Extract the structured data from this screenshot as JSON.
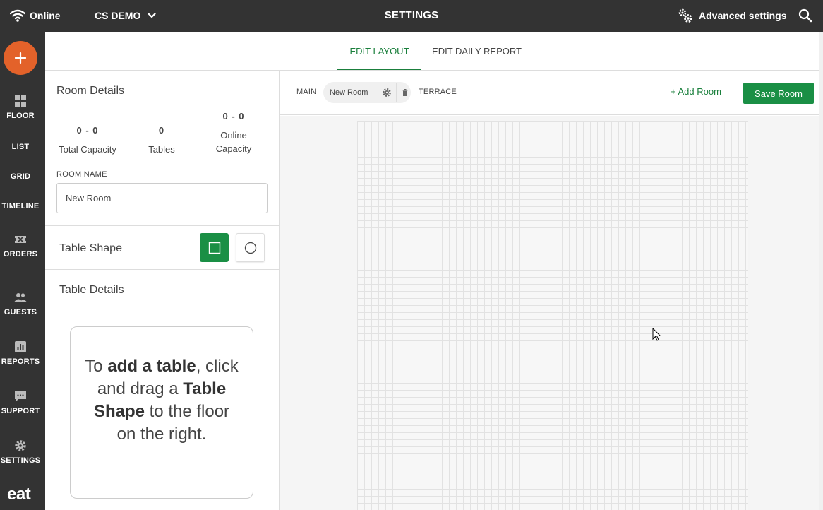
{
  "topbar": {
    "status": "Online",
    "venue": "CS DEMO",
    "title": "SETTINGS",
    "advanced": "Advanced settings",
    "icons": [
      "wifi-icon",
      "chevron-down-icon",
      "gears-icon",
      "search-icon"
    ]
  },
  "sidebar": {
    "items": [
      {
        "label": "FLOOR",
        "icon": "floor-icon"
      },
      {
        "label": "LIST",
        "icon": ""
      },
      {
        "label": "GRID",
        "icon": ""
      },
      {
        "label": "TIMELINE",
        "icon": ""
      },
      {
        "label": "ORDERS",
        "icon": "ticket-icon"
      },
      {
        "label": "GUESTS",
        "icon": "people-icon"
      },
      {
        "label": "REPORTS",
        "icon": "bar-chart-icon"
      },
      {
        "label": "SUPPORT",
        "icon": "chat-icon"
      },
      {
        "label": "SETTINGS",
        "icon": "gear-icon"
      }
    ],
    "brand": "eat"
  },
  "tabs": {
    "edit_layout": "EDIT LAYOUT",
    "edit_daily_report": "EDIT DAILY REPORT"
  },
  "room_details": {
    "title": "Room Details",
    "stats": [
      {
        "value": "0 - 0",
        "label": "Total Capacity"
      },
      {
        "value": "0",
        "label": "Tables"
      },
      {
        "value": "0 - 0",
        "label": "Online Capacity"
      }
    ],
    "room_name_label": "ROOM NAME",
    "room_name_value": "New Room"
  },
  "table_shape": {
    "label": "Table Shape",
    "selected": "square"
  },
  "table_details": {
    "title": "Table Details",
    "hint_1": "To ",
    "hint_bold_1": "add a table",
    "hint_2": ", click and drag a ",
    "hint_bold_2": "Table Shape",
    "hint_3": " to the floor on the right."
  },
  "rooms": {
    "main": "MAIN",
    "current": "New Room",
    "terrace": "TERRACE",
    "add_room": "+ Add Room",
    "save_room": "Save Room"
  },
  "colors": {
    "topbar": "#333333",
    "accent_green": "#1a8f45",
    "fab_orange": "#e3622a"
  }
}
